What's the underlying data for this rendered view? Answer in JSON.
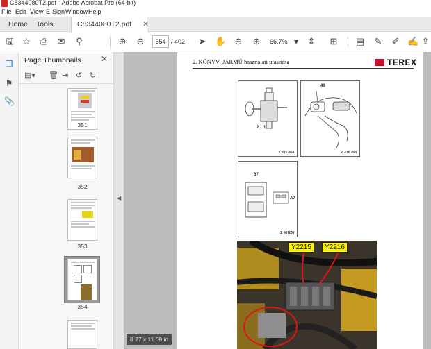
{
  "window": {
    "title": "C8344080T2.pdf - Adobe Acrobat Pro (64-bit)"
  },
  "menu": [
    "File",
    "Edit",
    "View",
    "E-Sign",
    "Window",
    "Help"
  ],
  "tabs": {
    "home": "Home",
    "tools": "Tools",
    "document": "C8344080T2.pdf"
  },
  "toolbar": {
    "page_current": "354",
    "page_total": "/ 402",
    "zoom": "66.7%"
  },
  "panel": {
    "title": "Page Thumbnails",
    "thumbnails": [
      {
        "label": "351"
      },
      {
        "label": "352"
      },
      {
        "label": "353"
      },
      {
        "label": "354",
        "selected": true
      }
    ]
  },
  "page": {
    "chapter_header": "2. KÖNYV: JÁRMŰ használati utasítása",
    "brand": "TEREX",
    "figures": [
      {
        "codes": [
          "2",
          "1"
        ],
        "ref": "Z 315 264"
      },
      {
        "codes": [
          "43"
        ],
        "ref": "Z 315 265"
      },
      {
        "codes": [
          "67",
          "A7"
        ],
        "ref": "Z 66 626"
      }
    ],
    "photo_tags": [
      "Y2215",
      "Y2216"
    ]
  },
  "status": {
    "page_size": "8.27 x 11.69 in"
  },
  "colors": {
    "accent_red": "#d8231f",
    "tag_yellow": "#fff200",
    "terex_red": "#c8102e"
  }
}
